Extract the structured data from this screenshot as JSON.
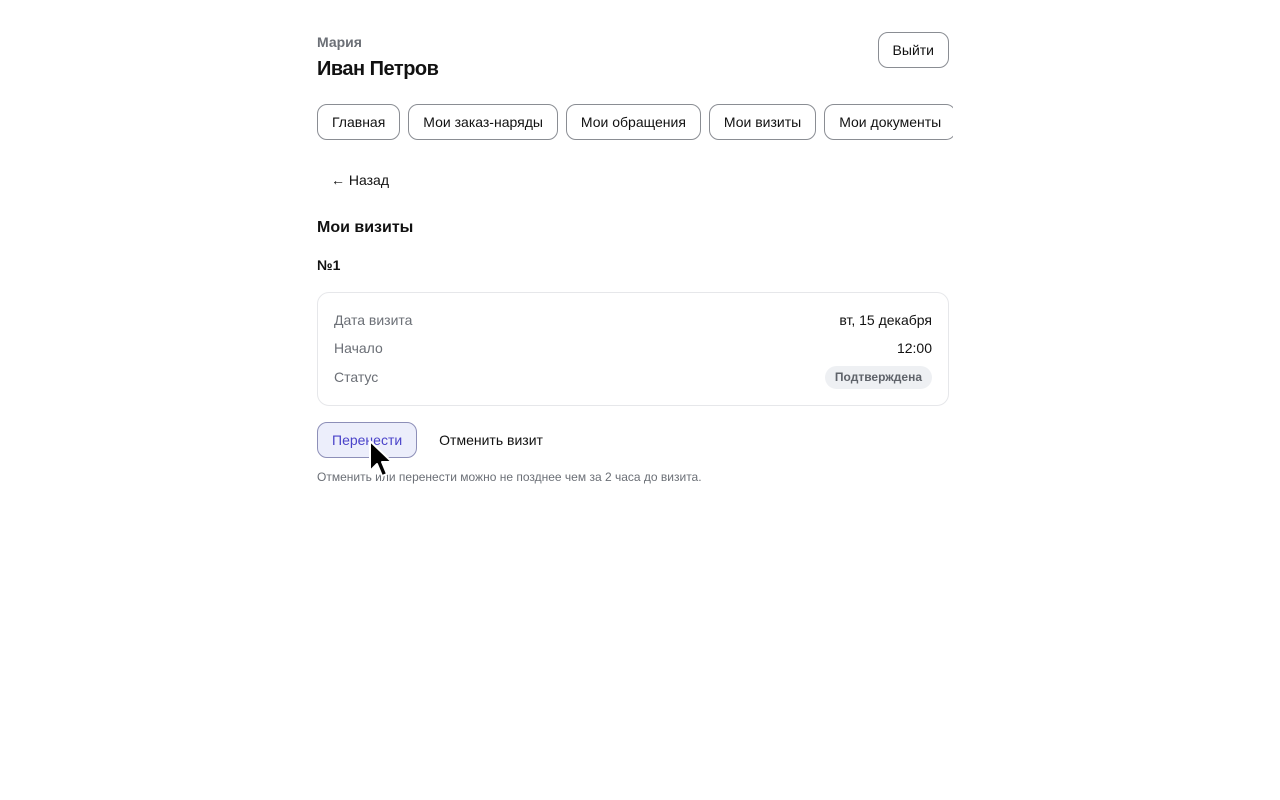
{
  "header": {
    "user_first_name": "Мария",
    "user_full_name": "Иван Петров",
    "logout_label": "Выйти"
  },
  "nav": {
    "tabs": [
      {
        "label": "Главная"
      },
      {
        "label": "Мои заказ-наряды"
      },
      {
        "label": "Мои обращения"
      },
      {
        "label": "Мои визиты"
      },
      {
        "label": "Мои документы"
      }
    ]
  },
  "back_label": "← Назад",
  "section_title": "Мои визиты",
  "visit": {
    "number": "№1",
    "rows": [
      {
        "label": "Дата визита",
        "value": "вт, 15 декабря"
      },
      {
        "label": "Начало",
        "value": "12:00"
      },
      {
        "label": "Статус",
        "value": "Подтверждена"
      }
    ],
    "status_color": "#eef0f3"
  },
  "actions": {
    "reschedule_label": "Перенести",
    "cancel_label": "Отменить визит"
  },
  "note": "Отменить или перенести можно не позднее чем за 2 часа до визита.",
  "colors": {
    "accent": "#4a43c9",
    "accent_bg": "#eceefb",
    "muted_text": "#6b6f76",
    "border": "#8a8d93"
  },
  "icons": {
    "cursor": "mouse-pointer-icon"
  }
}
